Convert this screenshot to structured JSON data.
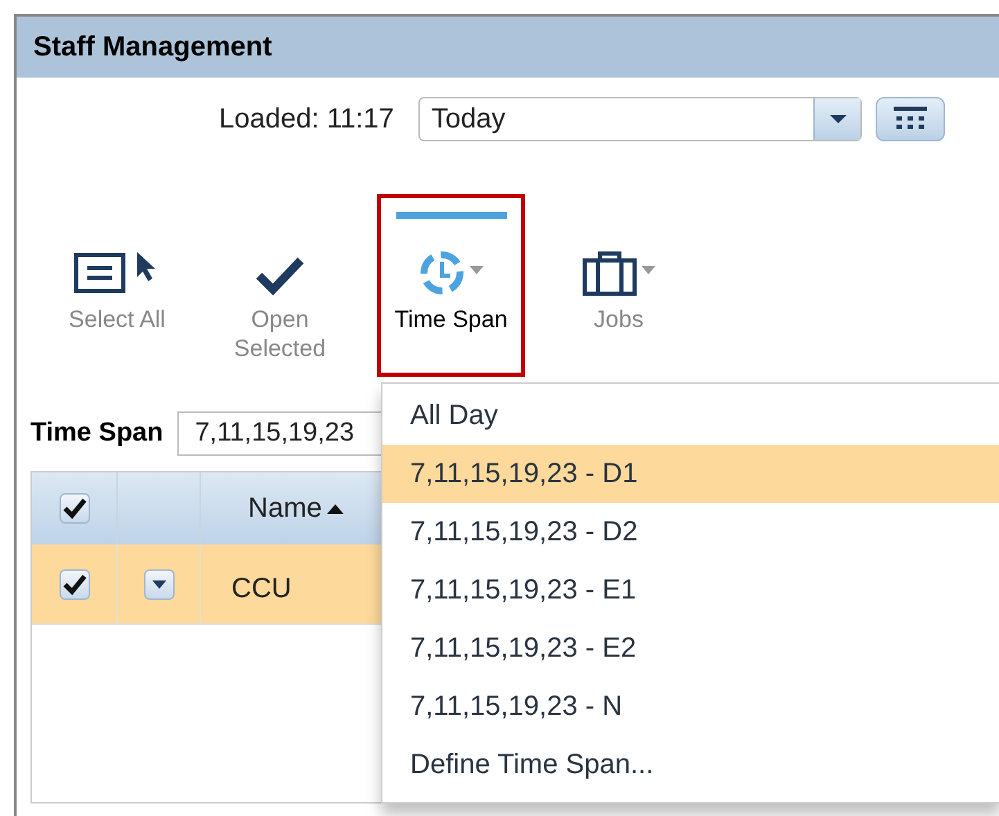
{
  "window": {
    "title": "Staff Management"
  },
  "loaded": {
    "label": "Loaded: 11:17"
  },
  "date_select": {
    "value": "Today"
  },
  "toolbar": [
    {
      "label": "Select All",
      "kind": "select_all",
      "selected": false,
      "has_menu": false
    },
    {
      "label": "Open Selected",
      "kind": "open_selected",
      "selected": false,
      "has_menu": false
    },
    {
      "label": "Time Span",
      "kind": "time_span",
      "selected": true,
      "has_menu": true
    },
    {
      "label": "Jobs",
      "kind": "jobs",
      "selected": false,
      "has_menu": true
    }
  ],
  "time_span_field": {
    "label": "Time Span",
    "value": "7,11,15,19,23"
  },
  "grid": {
    "header_checked": true,
    "columns": [
      {
        "label": "Name",
        "sort_ascending": true
      }
    ],
    "rows": [
      {
        "checked": true,
        "name": "CCU",
        "selected": true
      }
    ]
  },
  "dropdown": {
    "items": [
      {
        "label": "All Day",
        "selected": false
      },
      {
        "label": "7,11,15,19,23 - D1",
        "selected": true
      },
      {
        "label": "7,11,15,19,23 - D2",
        "selected": false
      },
      {
        "label": "7,11,15,19,23 - E1",
        "selected": false
      },
      {
        "label": "7,11,15,19,23 - E2",
        "selected": false
      },
      {
        "label": "7,11,15,19,23 - N",
        "selected": false
      },
      {
        "label": "Define Time Span...",
        "selected": false
      }
    ]
  }
}
